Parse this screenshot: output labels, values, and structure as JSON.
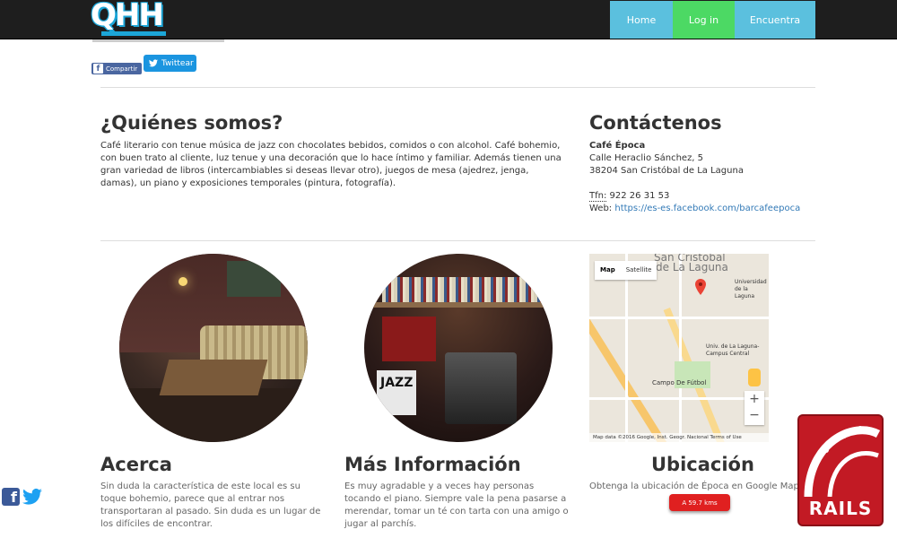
{
  "brand": {
    "logo_text": "QHH"
  },
  "nav": {
    "items": [
      "Home",
      "Log in",
      "Encuentra"
    ]
  },
  "share": {
    "facebook": "Compartir",
    "twitter": "Twittear"
  },
  "about": {
    "title": "¿Quiénes somos?",
    "text": "Café literario con tenue música de jazz con chocolates bebidos, comidos o con alcohol. Café bohemio, con buen trato al cliente, luz tenue y una decoración que lo hace íntimo y familiar. Además tienen una gran variedad de libros (intercambiables si deseas llevar otro), juegos de mesa (ajedrez, jenga, damas), un piano y exposiciones temporales (pintura, fotografía)."
  },
  "contact": {
    "title": "Contáctenos",
    "name": "Café Época",
    "street": "Calle Heraclio Sánchez, 5",
    "city": "38204 San Cristóbal de La Laguna",
    "phone_label": "Tfn:",
    "phone": "922 26 31 53",
    "web_label": "Web:",
    "web": "https://es-es.facebook.com/barcafeepoca"
  },
  "map": {
    "type_map": "Map",
    "type_satellite": "Satellite",
    "city_label_1": "San Cristóbal",
    "city_label_2": "de La Laguna",
    "campo": "Campo De Fútbol",
    "univ": "Univ. de La Laguna-Campus Central",
    "univ2": "Universidad de la Laguna",
    "zoom_in": "+",
    "zoom_out": "−",
    "footer": "Map data ©2016 Google, Inst. Geogr. Nacional   Terms of Use"
  },
  "columns": {
    "acerca": {
      "title": "Acerca",
      "text": "Sin duda la característica de este local es su toque bohemio, parece que al entrar nos transportaran al pasado. Sin duda es un lugar de los difíciles de encontrar."
    },
    "info": {
      "title": "Más Información",
      "text": "Es muy agradable y a veces hay personas tocando el piano. Siempre vale la pena pasarse a merendar, tomar un té con tarta con una amigo o jugar al parchís."
    },
    "ubicacion": {
      "title": "Ubicación",
      "text": "Obtenga la ubicación de Época en Google Maps"
    }
  },
  "distance_badge": "A 59.7 kms",
  "rails_badge": "RAILS",
  "poster_text": "JAZZ",
  "colors": {
    "nav_blue": "#5bc0de",
    "nav_green": "#4cd964",
    "link": "#337ab7",
    "rails": "#c21a24"
  }
}
